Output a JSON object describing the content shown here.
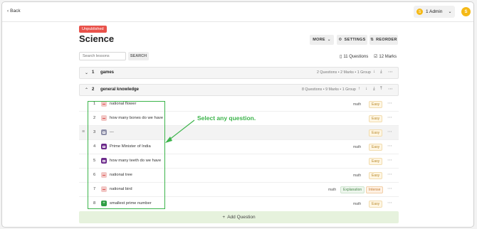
{
  "topbar": {
    "back_label": "Back",
    "admin_label": "1 Admin",
    "admin_dot": "S",
    "avatar_letter": "S"
  },
  "header": {
    "status_badge": "Unpublished",
    "title": "Science",
    "more_label": "MORE",
    "settings_label": "SETTINGS",
    "reorder_label": "REORDER",
    "search_placeholder": "Search lessons",
    "search_button": "SEARCH",
    "questions_stat": "11 Questions",
    "marks_stat": "12 Marks"
  },
  "sections": [
    {
      "num": "1",
      "name": "games",
      "meta": "2 Questions • 2 Marks • 1 Group",
      "expanded": false
    },
    {
      "num": "2",
      "name": "general knowledge",
      "meta": "8 Questions • 9 Marks • 1 Group",
      "expanded": true
    }
  ],
  "questions": [
    {
      "num": "1",
      "text": "national flower",
      "icon": "text-question-icon",
      "tags": [
        "math",
        "Easy"
      ]
    },
    {
      "num": "2",
      "text": "how many bones do we have",
      "icon": "text-question-icon",
      "tags": [
        "Easy"
      ]
    },
    {
      "num": "3",
      "text": "---",
      "icon": "media-question-icon",
      "tags": [
        "Easy"
      ]
    },
    {
      "num": "4",
      "text": "Prime Minister of India",
      "icon": "multiple-choice-icon",
      "tags": [
        "math",
        "Easy"
      ]
    },
    {
      "num": "5",
      "text": "how many teeth do we have",
      "icon": "multiple-choice-icon",
      "tags": [
        "Easy"
      ]
    },
    {
      "num": "6",
      "text": "national tree",
      "icon": "text-question-icon",
      "tags": [
        "math",
        "Easy"
      ]
    },
    {
      "num": "7",
      "text": "national bird",
      "icon": "text-question-icon",
      "tags": [
        "math",
        "Explanation",
        "Intense"
      ]
    },
    {
      "num": "8",
      "text": "smallest prime number",
      "icon": "numeric-question-icon",
      "tags": [
        "math",
        "Easy"
      ]
    }
  ],
  "add_question_label": "Add Question",
  "annotation": {
    "text": "Select any question."
  },
  "colors": {
    "unpublished": "#e9524b",
    "accent_green": "#3cb44b",
    "admin_yellow": "#f5b916",
    "add_question_bg": "#e6f2dd"
  }
}
